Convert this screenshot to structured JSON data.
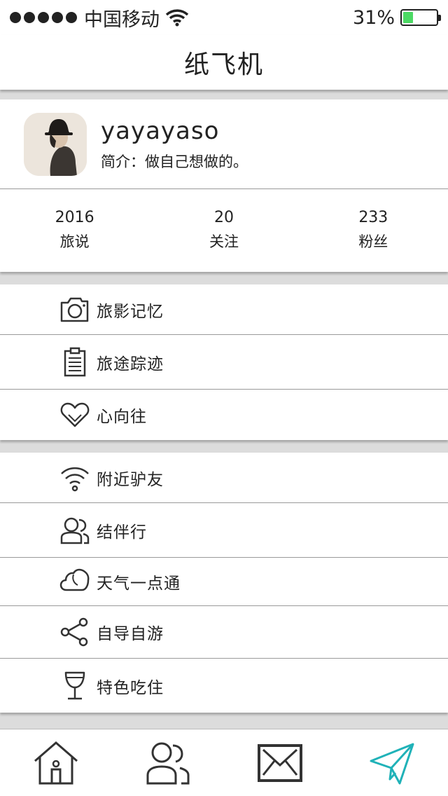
{
  "status_bar": {
    "carrier": "中国移动",
    "battery_text": "31%",
    "battery_level": 0.31,
    "battery_color": "#4cd964"
  },
  "nav": {
    "title": "纸飞机"
  },
  "profile": {
    "username": "yayayaso",
    "bio": "简介：做自己想做的。",
    "stats": [
      {
        "value": "2016",
        "label": "旅说"
      },
      {
        "value": "20",
        "label": "关注"
      },
      {
        "value": "233",
        "label": "粉丝"
      }
    ]
  },
  "menu_group_1": [
    {
      "label": "旅影记忆",
      "icon": "camera-icon"
    },
    {
      "label": "旅途踪迹",
      "icon": "clipboard-icon"
    },
    {
      "label": "心向往",
      "icon": "heart-icon"
    }
  ],
  "menu_group_2": [
    {
      "label": "附近驴友",
      "icon": "wifi-icon"
    },
    {
      "label": "结伴行",
      "icon": "users-icon"
    },
    {
      "label": "天气一点通",
      "icon": "cloud-icon"
    },
    {
      "label": "自导自游",
      "icon": "share-icon"
    },
    {
      "label": "特色吃住",
      "icon": "wine-glass-icon"
    }
  ],
  "tab_bar": {
    "active_color": "#20b2b8",
    "tabs": [
      {
        "icon": "home-icon",
        "active": false
      },
      {
        "icon": "friends-icon",
        "active": false
      },
      {
        "icon": "mail-icon",
        "active": false
      },
      {
        "icon": "paper-plane-icon",
        "active": true
      }
    ]
  }
}
